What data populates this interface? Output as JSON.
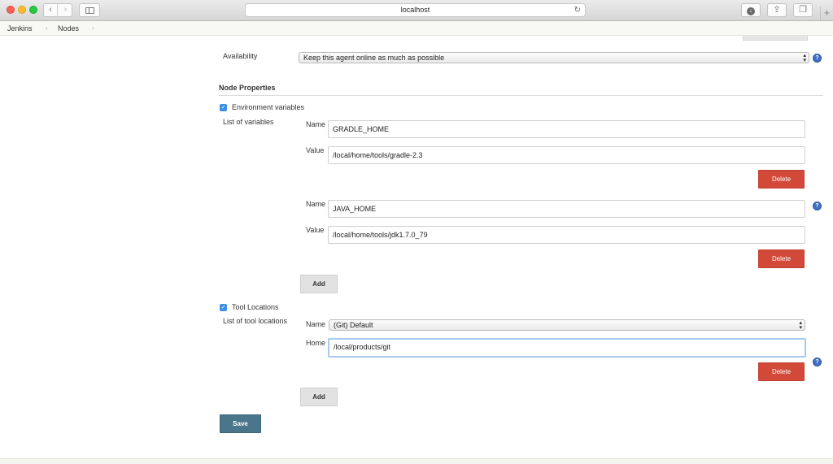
{
  "browser": {
    "url": "localhost",
    "back_glyph": "‹",
    "forward_glyph": "›",
    "reload_glyph": "↻",
    "download_glyph": "↓",
    "share_glyph": "⇪",
    "tabs_glyph": "❐",
    "newtab_glyph": "+",
    "icons": [
      "back-icon",
      "forward-icon",
      "sidebar-icon",
      "reload-icon",
      "download-icon",
      "share-icon",
      "tabs-icon",
      "new-tab-icon"
    ]
  },
  "breadcrumb": {
    "items": [
      "Jenkins",
      "Nodes"
    ],
    "separator": "›"
  },
  "form": {
    "availability": {
      "label": "Availability",
      "value": "Keep this agent online as much as possible"
    },
    "node_properties": {
      "title": "Node Properties",
      "env_vars": {
        "checkbox_label": "Environment variables",
        "list_label": "List of variables",
        "name_label": "Name",
        "value_label": "Value",
        "entries": [
          {
            "name": "GRADLE_HOME",
            "value": "/local/home/tools/gradle-2.3"
          },
          {
            "name": "JAVA_HOME",
            "value": "/local/home/tools/jdk1.7.0_79"
          }
        ],
        "delete_label": "Delete",
        "add_label": "Add"
      },
      "tool_locations": {
        "checkbox_label": "Tool Locations",
        "list_label": "List of tool locations",
        "name_label": "Name",
        "home_label": "Home",
        "name_value": "(Git) Default",
        "home_value": "/local/products/git",
        "delete_label": "Delete",
        "add_label": "Add"
      }
    },
    "save_label": "Save",
    "help_glyph": "?",
    "check_glyph": "✓"
  },
  "colors": {
    "delete": "#d24939",
    "save": "#4b758b",
    "help": "#3c6ec2",
    "checkbox": "#3b8fe6"
  }
}
